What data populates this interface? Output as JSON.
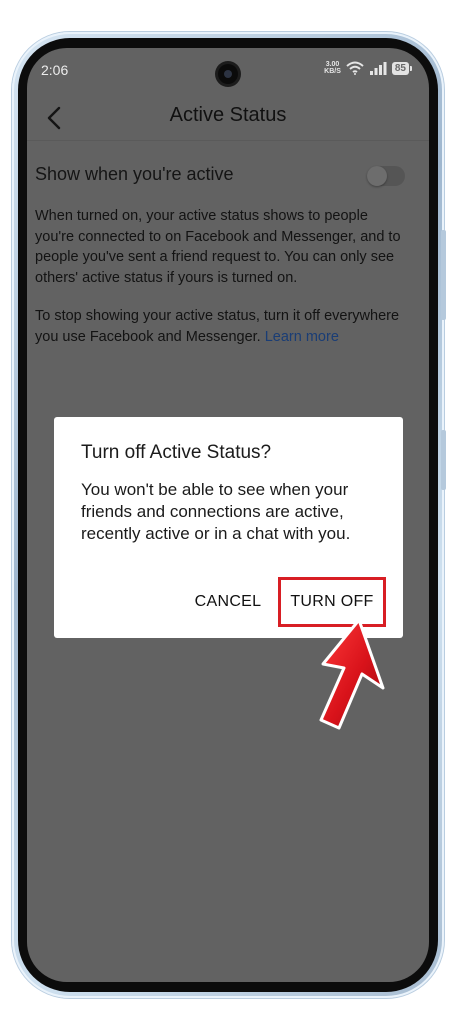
{
  "status_bar": {
    "time": "2:06",
    "net_speed_value": "3.00",
    "net_speed_unit": "KB/S",
    "battery": "85",
    "icons": [
      "wifi-icon",
      "signal-icon",
      "battery-icon"
    ]
  },
  "app_bar": {
    "title": "Active Status",
    "back_icon": "chevron-left-icon"
  },
  "setting": {
    "label": "Show when you're active",
    "toggle_on": false
  },
  "description": {
    "paragraph1": "When turned on, your active status shows to people you're connected to on Facebook and Messenger, and to people you've sent a friend request to. You can only see others' active status if yours is turned on.",
    "paragraph2_text": "To stop showing your active status, turn it off everywhere you use Facebook and Messenger.",
    "learn_more": "Learn more"
  },
  "dialog": {
    "title": "Turn off Active Status?",
    "body": "You won't be able to see when your friends and connections are active, recently active or in a chat with you.",
    "cancel_label": "CANCEL",
    "confirm_label": "TURN OFF"
  },
  "colors": {
    "scrim": "#626262",
    "dialog_bg": "#ffffff",
    "highlight": "#d81e24",
    "link": "#1a3d75"
  }
}
